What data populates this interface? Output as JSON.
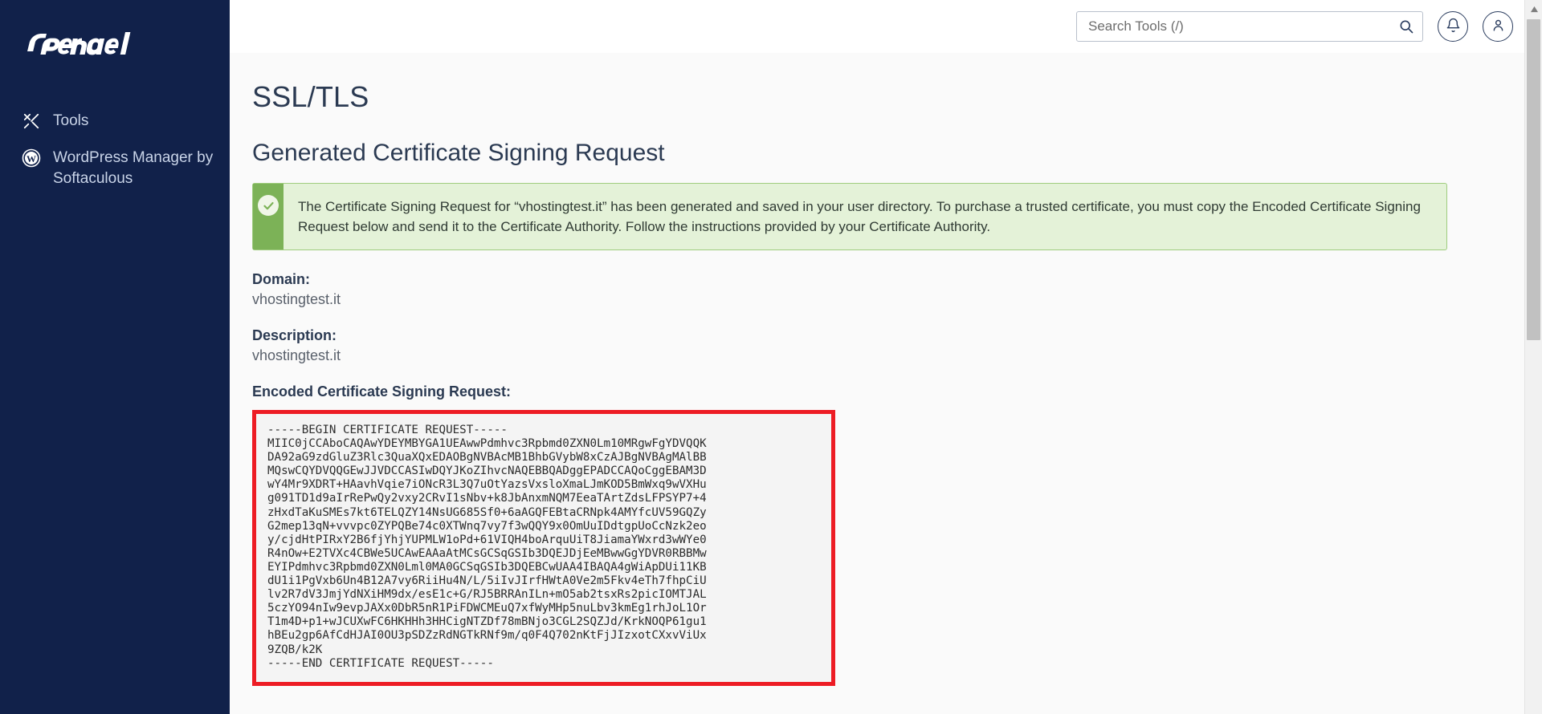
{
  "sidebar": {
    "brand": "cPanel",
    "items": [
      {
        "label": "Tools",
        "icon": "tools-icon"
      },
      {
        "label": "WordPress Manager by Softaculous",
        "icon": "wordpress-icon"
      }
    ]
  },
  "topbar": {
    "search": {
      "placeholder": "Search Tools (/)",
      "value": "",
      "icon": "search-icon"
    },
    "notifications_icon": "bell-icon",
    "account_icon": "user-icon"
  },
  "page": {
    "title": "SSL/TLS",
    "section_title": "Generated Certificate Signing Request"
  },
  "alert": {
    "type": "success",
    "icon": "check-circle-icon",
    "message": "The Certificate Signing Request for “vhostingtest.it” has been generated and saved in your user directory. To purchase a trusted certificate, you must copy the Encoded Certificate Signing Request below and send it to the Certificate Authority. Follow the instructions provided by your Certificate Authority."
  },
  "details": {
    "domain_label": "Domain:",
    "domain_value": "vhostingtest.it",
    "description_label": "Description:",
    "description_value": "vhostingtest.it",
    "csr_label": "Encoded Certificate Signing Request:"
  },
  "csr": {
    "text": "-----BEGIN CERTIFICATE REQUEST-----\nMIIC0jCCAboCAQAwYDEYMBYGA1UEAwwPdmhvc3Rpbmd0ZXN0Lm10MRgwFgYDVQQK\nDA92aG9zdGluZ3Rlc3QuaXQxEDAOBgNVBAcMB1BhbGVybW8xCzAJBgNVBAgMAlBB\nMQswCQYDVQQGEwJJVDCCASIwDQYJKoZIhvcNAQEBBQADggEPADCCAQoCggEBAM3D\nwY4Mr9XDRT+HAavhVqie7iONcR3L3Q7uOtYazsVxsloXmaLJmKOD5BmWxq9wVXHu\ng091TD1d9aIrRePwQy2vxy2CRvI1sNbv+k8JbAnxmNQM7EeaTArtZdsLFPSYP7+4\nzHxdTaKuSMEs7kt6TELQZY14NsUG685Sf0+6aAGQFEBtaCRNpk4AMYfcUV59GQZy\nG2mep13qN+vvvpc0ZYPQBe74c0XTWnq7vy7f3wQQY9x0OmUuIDdtgpUoCcNzk2eo\ny/cjdHtPIRxY2B6fjYhjYUPMLW1oPd+61VIQH4boArquUiT8JiamaYWxrd3wWYe0\nR4nOw+E2TVXc4CBWe5UCAwEAAaAtMCsGCSqGSIb3DQEJDjEeMBwwGgYDVR0RBBMw\nEYIPdmhvc3Rpbmd0ZXN0Lml0MA0GCSqGSIb3DQEBCwUAA4IBAQA4gWiApDUi11KB\ndU1i1PgVxb6Un4B12A7vy6RiiHu4N/L/5iIvJIrfHWtA0Ve2m5Fkv4eTh7fhpCiU\nlv2R7dV3JmjYdNXiHM9dx/esE1c+G/RJ5BRRAnILn+mO5ab2tsxRs2picIOMTJAL\n5czYO94nIw9evpJAXx0DbR5nR1PiFDWCMEuQ7xfWyMHp5nuLbv3kmEg1rhJoL1Or\nT1m4D+p1+wJCUXwFC6HKHHh3HHCigNTZDf78mBNjo3CGL2SQZJd/KrkNOQP61gu1\nhBEu2gp6AfCdHJAI0OU3pSDZzRdNGTkRNf9m/q0F4Q702nKtFjJIzxotCXxvViUx\n9ZQB/k2K\n-----END CERTIFICATE REQUEST-----"
  }
}
